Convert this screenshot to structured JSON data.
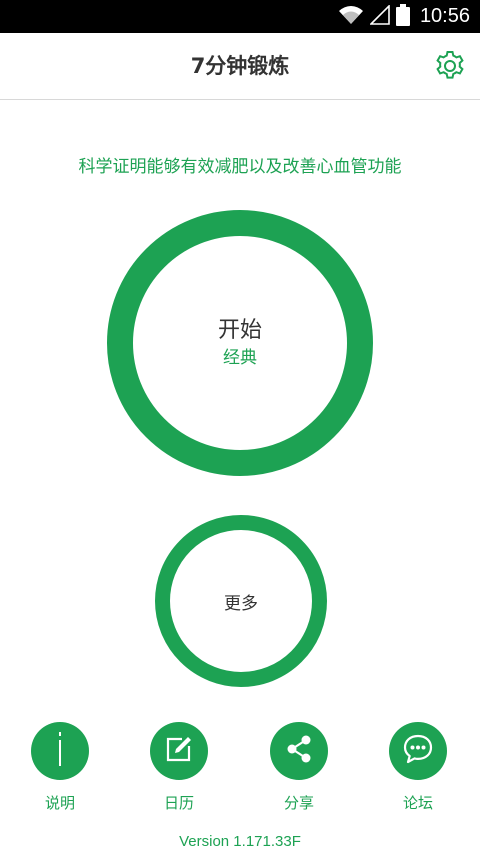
{
  "status_bar": {
    "time": "10:56",
    "icons": [
      "wifi-icon",
      "signal-icon",
      "battery-icon"
    ]
  },
  "app_bar": {
    "title": "7分钟锻炼",
    "settings_icon": "gear-icon"
  },
  "tagline": "科学证明能够有效减肥以及改善心血管功能",
  "start_button": {
    "label": "开始",
    "mode": "经典"
  },
  "more_button": {
    "label": "更多"
  },
  "bottom_nav": {
    "items": [
      {
        "label": "说明",
        "icon": "info-icon"
      },
      {
        "label": "日历",
        "icon": "edit-icon"
      },
      {
        "label": "分享",
        "icon": "share-icon"
      },
      {
        "label": "论坛",
        "icon": "chat-icon"
      }
    ]
  },
  "version": "Version 1.171.33F",
  "colors": {
    "accent": "#1da253",
    "text": "#333333",
    "status_bar": "#000000"
  }
}
